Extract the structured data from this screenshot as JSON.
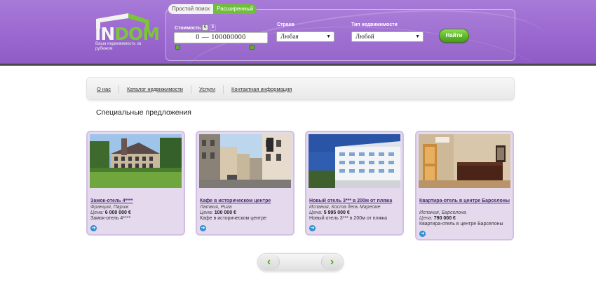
{
  "brand": {
    "logo_text_a": "IN",
    "logo_text_b": "DOM",
    "tagline": "Ваша недвижимость за рубежом"
  },
  "search": {
    "tab_simple": "Простой поиск",
    "tab_advanced": "Расширенный",
    "cost_label": "Стоимость",
    "cost_range": "0 — 100000000",
    "country_label": "Страна",
    "country_value": "Любая",
    "type_label": "Тип недвижимости",
    "type_value": "Любой",
    "find_label": "Найти"
  },
  "nav": {
    "items": [
      {
        "label": "О нас"
      },
      {
        "label": "Каталог недвижимости"
      },
      {
        "label": "Услуги"
      },
      {
        "label": "Контактная информация"
      }
    ]
  },
  "main": {
    "section_title": "Специальные предложения",
    "price_label": "Цена:",
    "cards": [
      {
        "title": "Замок-отель 4****",
        "location": "Франция, Париж",
        "price": "6 000 000 €",
        "desc": "Замок-отель 4****"
      },
      {
        "title": "Кафе в историческом центре",
        "location": "Латвия, Рига",
        "price": "100 000 €",
        "desc": "Кафе в историческом центре"
      },
      {
        "title": "Новый отель 3*** в 200м от пляжа",
        "location": "Испания, Коста дель Маресме",
        "price": "5 995 000 €",
        "desc": "Новый отель 3*** в 200м от пляжа"
      },
      {
        "title": "Квартира-отель в центре Барселоны",
        "location": "Испания, Барселона",
        "price": "790 000 €",
        "desc": "Квартира-отель в центре Барселоны"
      }
    ]
  },
  "colors": {
    "header_purple": "#9a68cf",
    "accent_green": "#6fbf3a",
    "card_bg": "#e4d9ed"
  }
}
